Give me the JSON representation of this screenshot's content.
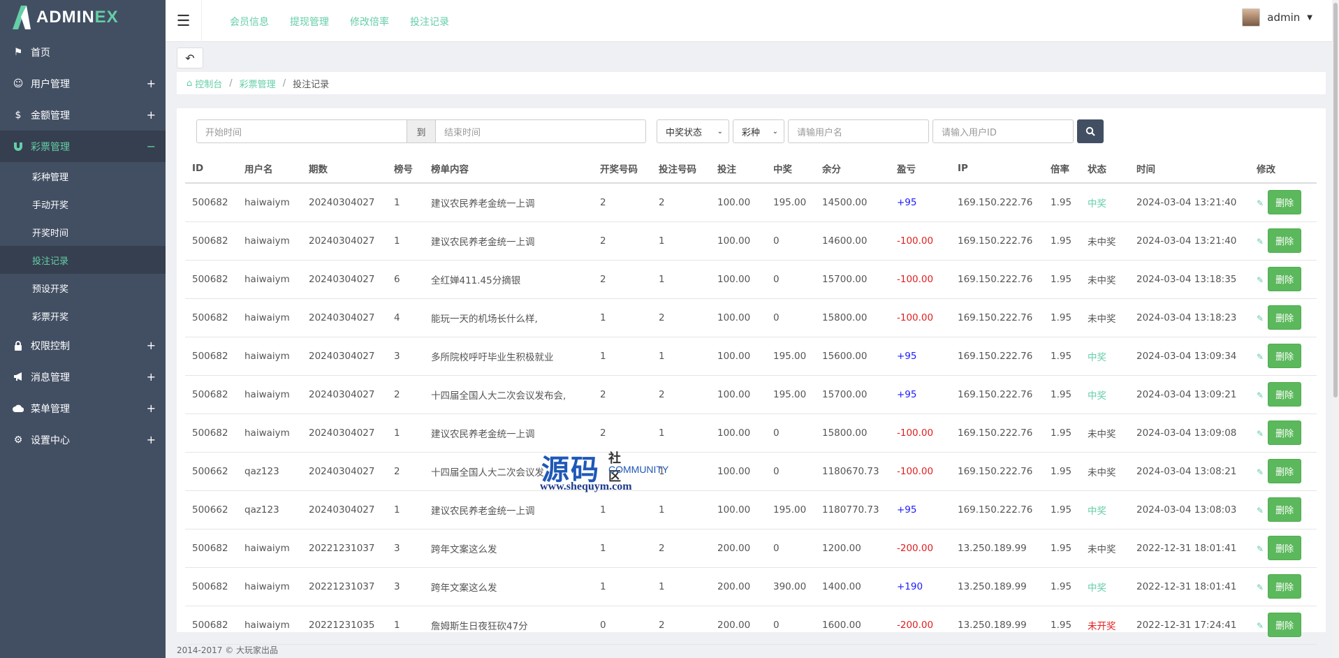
{
  "logo": {
    "text_main": "ADMIN",
    "text_accent": "EX"
  },
  "sidebar": {
    "items": [
      {
        "label": "首页",
        "icon": "flag-icon"
      },
      {
        "label": "用户管理",
        "icon": "smile-icon",
        "toggle": "+"
      },
      {
        "label": "金额管理",
        "icon": "dollar-icon",
        "toggle": "+"
      },
      {
        "label": "彩票管理",
        "icon": "magnet-icon",
        "toggle": "−"
      },
      {
        "label": "权限控制",
        "icon": "lock-icon",
        "toggle": "+"
      },
      {
        "label": "消息管理",
        "icon": "bullhorn-icon",
        "toggle": "+"
      },
      {
        "label": "菜单管理",
        "icon": "cloud-icon",
        "toggle": "+"
      },
      {
        "label": "设置中心",
        "icon": "gear-icon",
        "toggle": "+"
      }
    ],
    "sub_items": [
      "彩种管理",
      "手动开奖",
      "开奖时间",
      "投注记录",
      "预设开奖",
      "彩票开奖"
    ]
  },
  "topbar": {
    "links": [
      "会员信息",
      "提现管理",
      "修改倍率",
      "投注记录"
    ],
    "user": "admin"
  },
  "breadcrumb": {
    "home": "控制台",
    "mid": "彩票管理",
    "current": "投注记录"
  },
  "filter": {
    "start_placeholder": "开始时间",
    "to": "到",
    "end_placeholder": "结束时间",
    "status_select": "中奖状态",
    "type_select": "彩种",
    "username_placeholder": "请输用户名",
    "userid_placeholder": "请输入用户ID"
  },
  "table": {
    "headers": [
      "ID",
      "用户名",
      "期数",
      "榜号",
      "榜单内容",
      "开奖号码",
      "投注号码",
      "投注",
      "中奖",
      "余分",
      "盈亏",
      "IP",
      "倍率",
      "状态",
      "时间",
      "修改"
    ],
    "delete_label": "删除",
    "rows": [
      {
        "id": "500682",
        "user": "haiwaiym",
        "period": "20240304027",
        "rank": "1",
        "content": "建议农民养老金统一上调",
        "draw": "2",
        "bet_no": "2",
        "bet": "100.00",
        "win": "195.00",
        "balance": "14500.00",
        "pl": "+95",
        "pl_type": "pos",
        "ip": "169.150.222.76",
        "rate": "1.95",
        "status": "中奖",
        "status_type": "win",
        "time": "2024-03-04 13:21:40"
      },
      {
        "id": "500682",
        "user": "haiwaiym",
        "period": "20240304027",
        "rank": "1",
        "content": "建议农民养老金统一上调",
        "draw": "2",
        "bet_no": "1",
        "bet": "100.00",
        "win": "0",
        "balance": "14600.00",
        "pl": "-100.00",
        "pl_type": "neg",
        "ip": "169.150.222.76",
        "rate": "1.95",
        "status": "未中奖",
        "status_type": "lose",
        "time": "2024-03-04 13:21:40"
      },
      {
        "id": "500682",
        "user": "haiwaiym",
        "period": "20240304027",
        "rank": "6",
        "content": "全红婵411.45分摘银",
        "draw": "2",
        "bet_no": "1",
        "bet": "100.00",
        "win": "0",
        "balance": "15700.00",
        "pl": "-100.00",
        "pl_type": "neg",
        "ip": "169.150.222.76",
        "rate": "1.95",
        "status": "未中奖",
        "status_type": "lose",
        "time": "2024-03-04 13:18:35"
      },
      {
        "id": "500682",
        "user": "haiwaiym",
        "period": "20240304027",
        "rank": "4",
        "content": "能玩一天的机场长什么样,",
        "draw": "1",
        "bet_no": "2",
        "bet": "100.00",
        "win": "0",
        "balance": "15800.00",
        "pl": "-100.00",
        "pl_type": "neg",
        "ip": "169.150.222.76",
        "rate": "1.95",
        "status": "未中奖",
        "status_type": "lose",
        "time": "2024-03-04 13:18:23"
      },
      {
        "id": "500682",
        "user": "haiwaiym",
        "period": "20240304027",
        "rank": "3",
        "content": "多所院校呼吁毕业生积极就业",
        "draw": "1",
        "bet_no": "1",
        "bet": "100.00",
        "win": "195.00",
        "balance": "15600.00",
        "pl": "+95",
        "pl_type": "pos",
        "ip": "169.150.222.76",
        "rate": "1.95",
        "status": "中奖",
        "status_type": "win",
        "time": "2024-03-04 13:09:34"
      },
      {
        "id": "500682",
        "user": "haiwaiym",
        "period": "20240304027",
        "rank": "2",
        "content": "十四届全国人大二次会议发布会,",
        "draw": "2",
        "bet_no": "2",
        "bet": "100.00",
        "win": "195.00",
        "balance": "15700.00",
        "pl": "+95",
        "pl_type": "pos",
        "ip": "169.150.222.76",
        "rate": "1.95",
        "status": "中奖",
        "status_type": "win",
        "time": "2024-03-04 13:09:21"
      },
      {
        "id": "500682",
        "user": "haiwaiym",
        "period": "20240304027",
        "rank": "1",
        "content": "建议农民养老金统一上调",
        "draw": "2",
        "bet_no": "1",
        "bet": "100.00",
        "win": "0",
        "balance": "15800.00",
        "pl": "-100.00",
        "pl_type": "neg",
        "ip": "169.150.222.76",
        "rate": "1.95",
        "status": "未中奖",
        "status_type": "lose",
        "time": "2024-03-04 13:09:08"
      },
      {
        "id": "500662",
        "user": "qaz123",
        "period": "20240304027",
        "rank": "2",
        "content": "十四届全国人大二次会议发",
        "draw": "",
        "bet_no": "1",
        "bet": "100.00",
        "win": "0",
        "balance": "1180670.73",
        "pl": "-100.00",
        "pl_type": "neg",
        "ip": "169.150.222.76",
        "rate": "1.95",
        "status": "未中奖",
        "status_type": "lose",
        "time": "2024-03-04 13:08:21"
      },
      {
        "id": "500662",
        "user": "qaz123",
        "period": "20240304027",
        "rank": "1",
        "content": "建议农民养老金统一上调",
        "draw": "1",
        "bet_no": "1",
        "bet": "100.00",
        "win": "195.00",
        "balance": "1180770.73",
        "pl": "+95",
        "pl_type": "pos",
        "ip": "169.150.222.76",
        "rate": "1.95",
        "status": "中奖",
        "status_type": "win",
        "time": "2024-03-04 13:08:03"
      },
      {
        "id": "500682",
        "user": "haiwaiym",
        "period": "20221231037",
        "rank": "3",
        "content": "跨年文案这么发",
        "draw": "1",
        "bet_no": "2",
        "bet": "200.00",
        "win": "0",
        "balance": "1200.00",
        "pl": "-200.00",
        "pl_type": "neg",
        "ip": "13.250.189.99",
        "rate": "1.95",
        "status": "未中奖",
        "status_type": "lose",
        "time": "2022-12-31 18:01:41"
      },
      {
        "id": "500682",
        "user": "haiwaiym",
        "period": "20221231037",
        "rank": "3",
        "content": "跨年文案这么发",
        "draw": "1",
        "bet_no": "1",
        "bet": "200.00",
        "win": "390.00",
        "balance": "1400.00",
        "pl": "+190",
        "pl_type": "pos",
        "ip": "13.250.189.99",
        "rate": "1.95",
        "status": "中奖",
        "status_type": "win",
        "time": "2022-12-31 18:01:41"
      },
      {
        "id": "500682",
        "user": "haiwaiym",
        "period": "20221231035",
        "rank": "1",
        "content": "詹姆斯生日夜狂砍47分",
        "draw": "0",
        "bet_no": "2",
        "bet": "200.00",
        "win": "0",
        "balance": "1600.00",
        "pl": "-200.00",
        "pl_type": "neg",
        "ip": "13.250.189.99",
        "rate": "1.95",
        "status": "未开奖",
        "status_type": "notyet",
        "time": "2022-12-31 17:24:41"
      }
    ]
  },
  "watermark": {
    "big": "源码",
    "small": "社区",
    "community": "COMMUNITY",
    "url": "www.shequym.com"
  },
  "footer": "2014-2017 © 大玩家出品"
}
